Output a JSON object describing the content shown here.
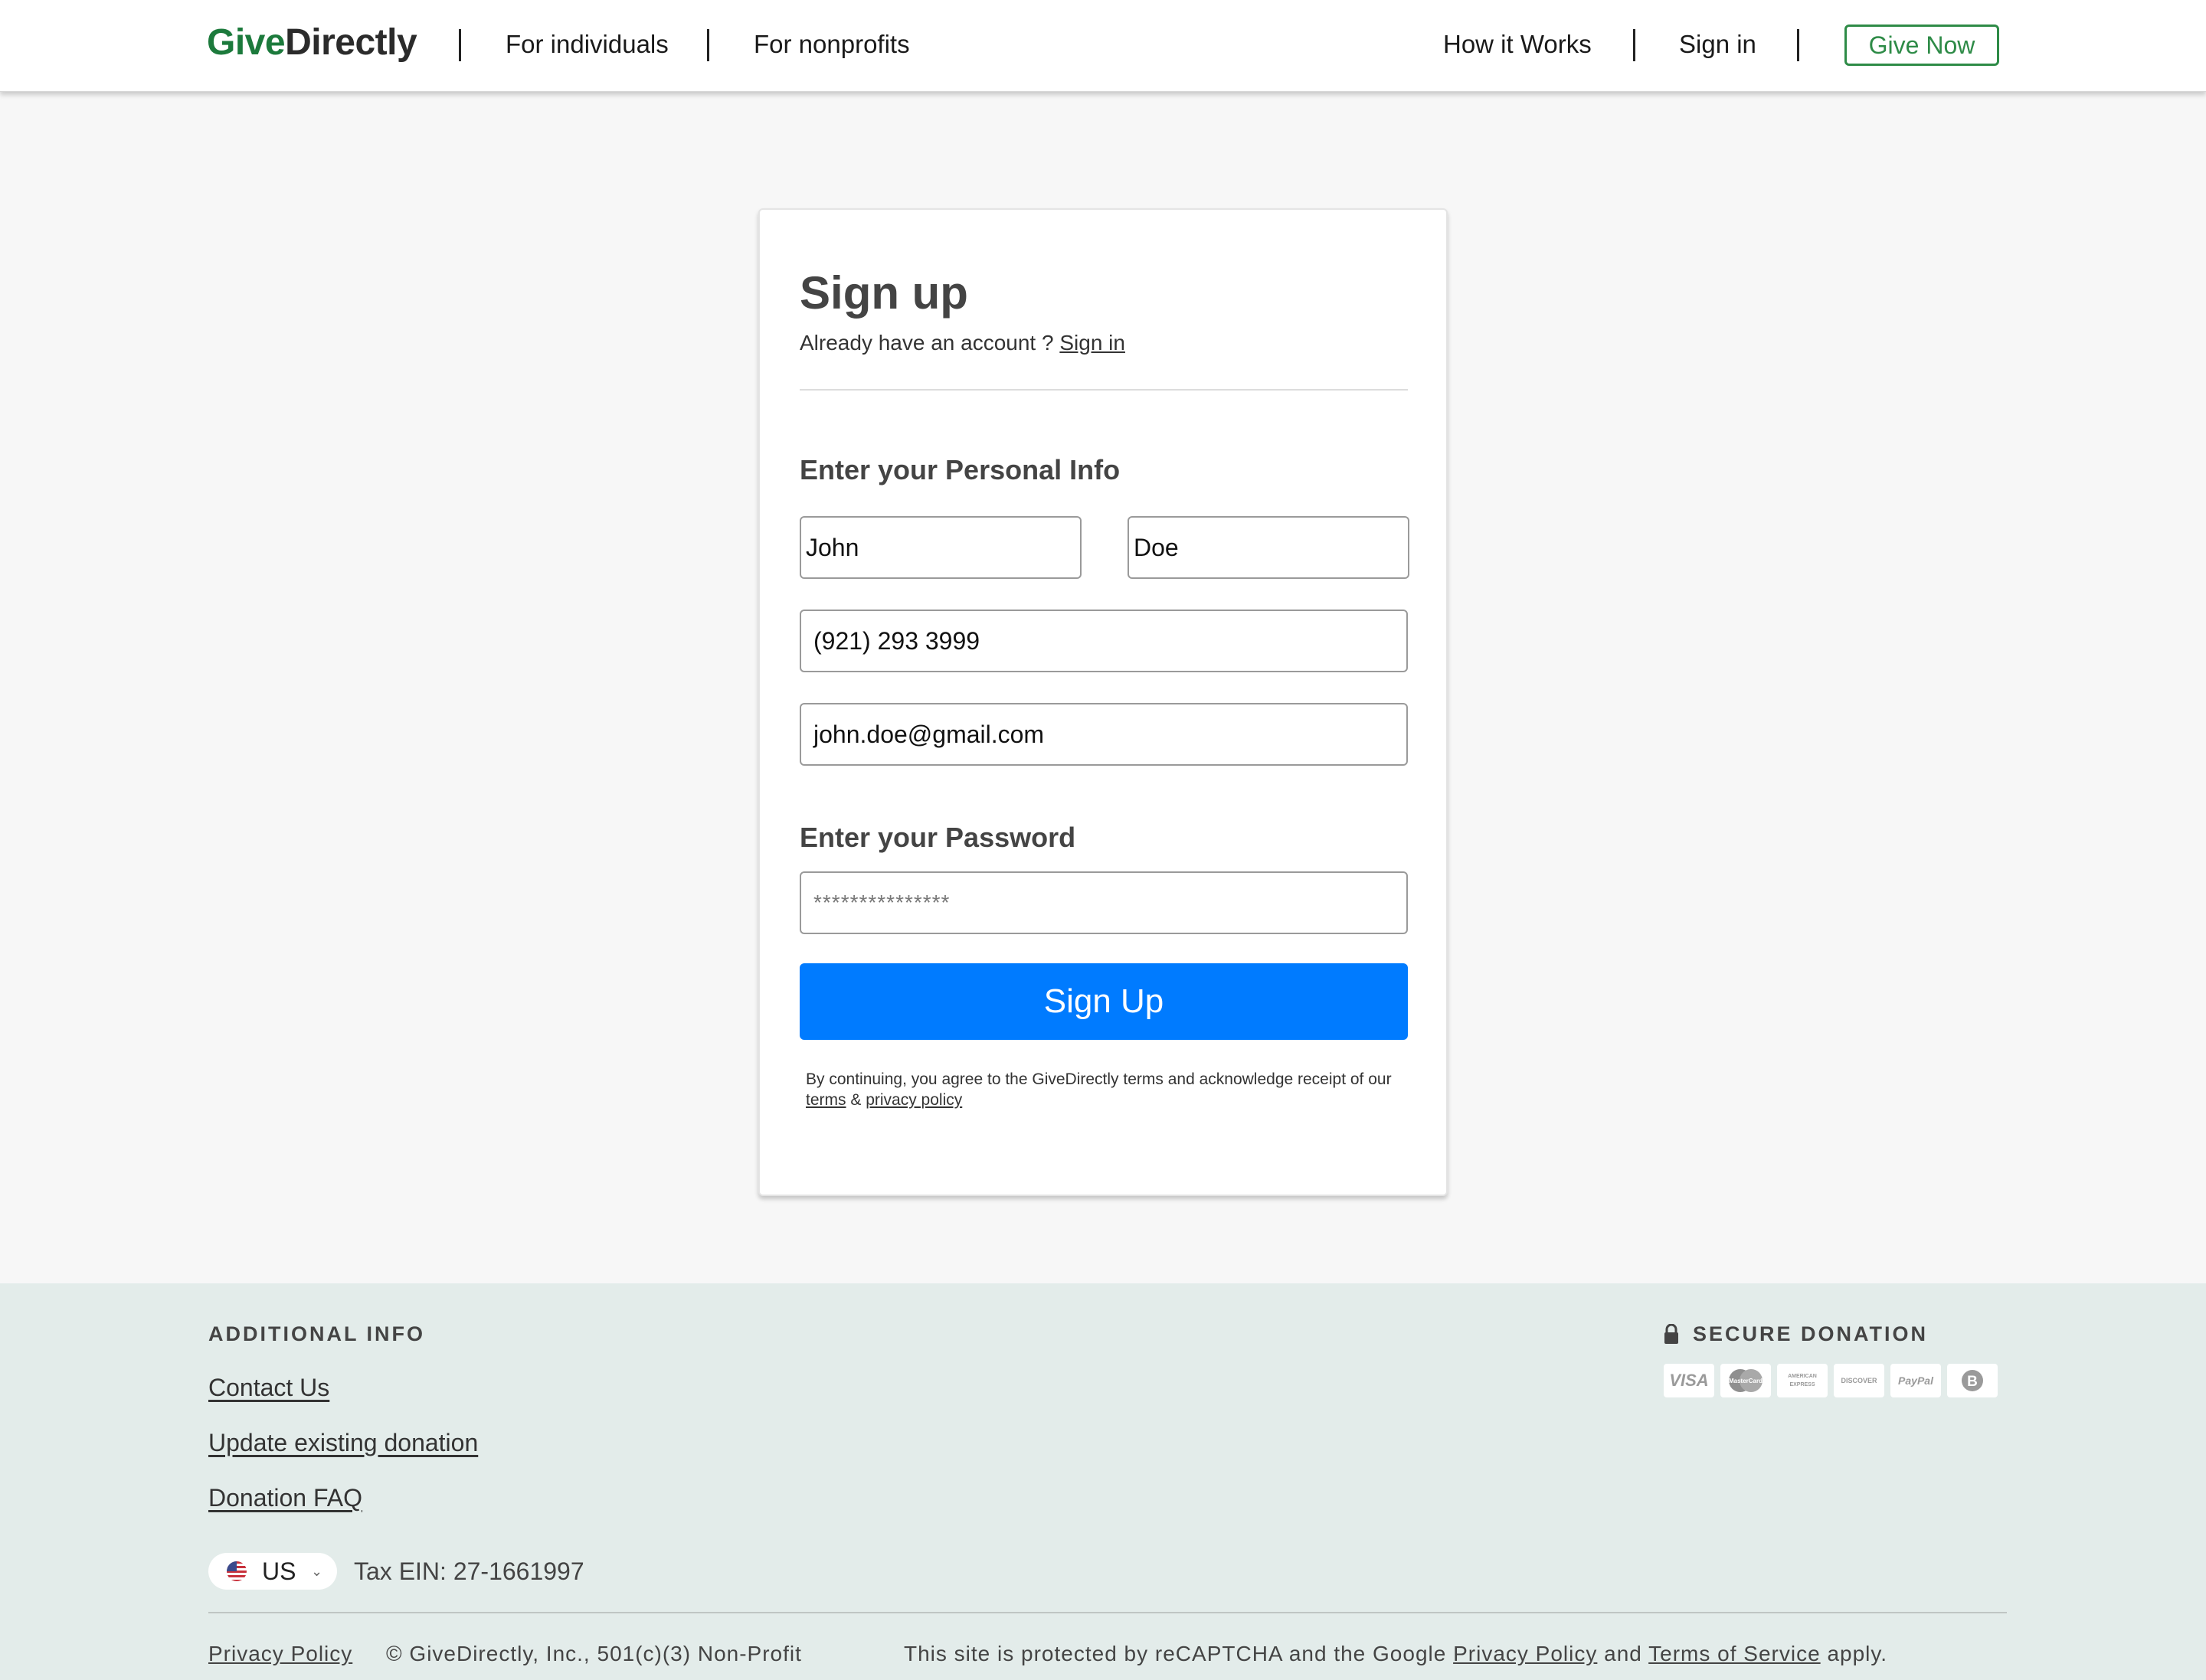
{
  "header": {
    "logo_part1": "Give",
    "logo_part2": "Directly",
    "nav_left": [
      "For individuals",
      "For nonprofits"
    ],
    "nav_right": [
      "How it Works",
      "Sign in"
    ],
    "cta": "Give Now"
  },
  "signup": {
    "title": "Sign up",
    "have_account": "Already have an account ?",
    "signin_link": "Sign in",
    "personal_heading": "Enter your Personal Info",
    "first_name": "John",
    "last_name": "Doe",
    "phone": "(921) 293 3999",
    "email": "john.doe@gmail.com",
    "password_heading": "Enter your Password",
    "password": "***************",
    "submit": "Sign Up",
    "terms_prefix": "By continuing, you agree to the GiveDirectly terms and acknowledge receipt of our",
    "terms_link": "terms",
    "terms_amp": "&",
    "privacy_link": "privacy policy"
  },
  "footer": {
    "additional_heading": "ADDITIONAL INFO",
    "links": [
      "Contact Us",
      "Update existing donation",
      "Donation FAQ"
    ],
    "secure_heading": "SECURE DONATION",
    "payment_icons": [
      "VISA",
      "MasterCard",
      "AMERICAN EXPRESS",
      "DISCOVER",
      "PayPal",
      "B"
    ],
    "country": "US",
    "tax_ein": "Tax EIN: 27-1661997",
    "privacy_policy": "Privacy Policy",
    "copyright": "© GiveDirectly, Inc., 501(c)(3) Non-Profit",
    "recaptcha_prefix": "This site is protected by reCAPTCHA and the Google",
    "recaptcha_privacy": "Privacy Policy",
    "recaptcha_and": "and",
    "recaptcha_terms": "Terms of Service",
    "recaptcha_suffix": "apply."
  },
  "colors": {
    "brand_green": "#1c7a3c",
    "primary_blue": "#007bff",
    "footer_bg": "#e3ecea"
  }
}
